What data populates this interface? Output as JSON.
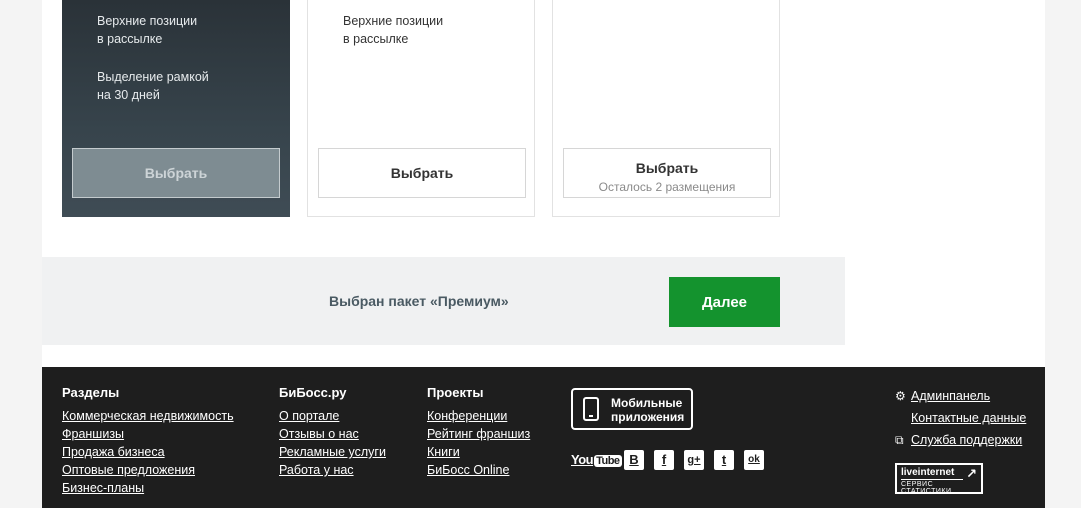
{
  "packages": [
    {
      "features": [
        "Верхние позиции|в рассылке",
        "Выделение рамкой|на 30 дней"
      ],
      "button_label": "Выбрать"
    },
    {
      "features": [
        "Верхние позиции|в рассылке"
      ],
      "button_label": "Выбрать"
    },
    {
      "features": [],
      "button_label": "Выбрать",
      "button_sub": "Осталось 2 размещения"
    }
  ],
  "summary": {
    "text": "Выбран пакет «Премиум»",
    "next_label": "Далее"
  },
  "footer": {
    "sections": {
      "title": "Разделы",
      "links": [
        "Коммерческая недвижимость",
        "Франшизы",
        "Продажа бизнеса",
        "Оптовые предложения",
        "Бизнес-планы"
      ]
    },
    "bibossru": {
      "title": "БиБосс.ру",
      "links": [
        "О портале",
        "Отзывы о нас",
        "Рекламные услуги",
        "Работа у нас"
      ]
    },
    "projects": {
      "title": "Проекты",
      "links": [
        "Конференции",
        "Рейтинг франшиз",
        "Книги",
        "БиБосс Online"
      ]
    },
    "mobile": {
      "line1": "Мобильные",
      "line2": "приложения"
    },
    "social": {
      "youtube_you": "You",
      "youtube_tube": "Tube",
      "vk": "В",
      "facebook": "f",
      "gplus": "g+",
      "twitter": "t",
      "ok": "ok"
    },
    "admin_links": [
      "Админпанель",
      "Контактные данные",
      "Служба поддержки"
    ],
    "liveinternet": {
      "name": "liveinternet",
      "sub": "СЕРВИС СТАТИСТИКИ"
    }
  },
  "colors": {
    "next_button": "#14932e",
    "premium_card": "#37444c",
    "footer": "#1e1e1e"
  }
}
